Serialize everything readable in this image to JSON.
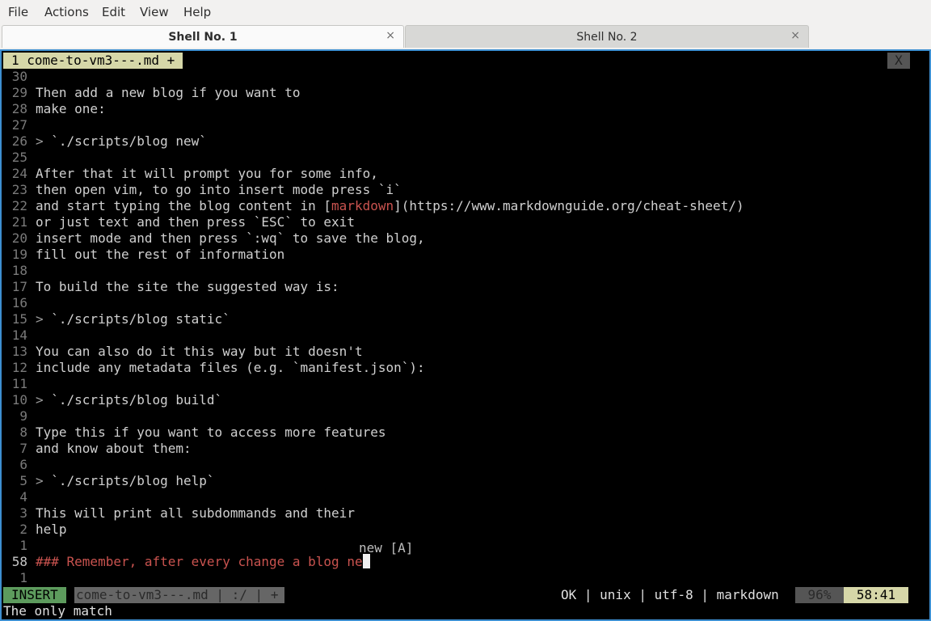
{
  "menubar": [
    "File",
    "Actions",
    "Edit",
    "View",
    "Help"
  ],
  "tabs": [
    {
      "label": "Shell No. 1",
      "close": "×"
    },
    {
      "label": "Shell No. 2",
      "close": "×"
    }
  ],
  "editor": {
    "buffer_tab": "1 come-to-vm3---.md +",
    "buffer_close": "X",
    "lines": [
      {
        "n": "30",
        "segs": []
      },
      {
        "n": "29",
        "segs": [
          {
            "t": "Then add a new blog if you want to"
          }
        ]
      },
      {
        "n": "28",
        "segs": [
          {
            "t": "make one:"
          }
        ]
      },
      {
        "n": "27",
        "segs": []
      },
      {
        "n": "26",
        "segs": [
          {
            "t": "> ",
            "c": "gray"
          },
          {
            "t": "`./scripts/blog new`"
          }
        ]
      },
      {
        "n": "25",
        "segs": []
      },
      {
        "n": "24",
        "segs": [
          {
            "t": "After that it will prompt you for some info,"
          }
        ]
      },
      {
        "n": "23",
        "segs": [
          {
            "t": "then open vim, to go into insert mode press `i`"
          }
        ]
      },
      {
        "n": "22",
        "segs": [
          {
            "t": "and start typing the blog content in ["
          },
          {
            "t": "markdown",
            "c": "red"
          },
          {
            "t": "](https://www.markdownguide.org/cheat-sheet/)"
          }
        ]
      },
      {
        "n": "21",
        "segs": [
          {
            "t": "or just text and then press `ESC` to exit"
          }
        ]
      },
      {
        "n": "20",
        "segs": [
          {
            "t": "insert mode and then press `:wq` to save the blog,"
          }
        ]
      },
      {
        "n": "19",
        "segs": [
          {
            "t": "fill out the rest of information"
          }
        ]
      },
      {
        "n": "18",
        "segs": []
      },
      {
        "n": "17",
        "segs": [
          {
            "t": "To build the site the suggested way is:"
          }
        ]
      },
      {
        "n": "16",
        "segs": []
      },
      {
        "n": "15",
        "segs": [
          {
            "t": "> ",
            "c": "gray"
          },
          {
            "t": "`./scripts/blog static`"
          }
        ]
      },
      {
        "n": "14",
        "segs": []
      },
      {
        "n": "13",
        "segs": [
          {
            "t": "You can also do it this way but it doesn't"
          }
        ]
      },
      {
        "n": "12",
        "segs": [
          {
            "t": "include any metadata files (e.g. `manifest.json`):"
          }
        ]
      },
      {
        "n": "11",
        "segs": []
      },
      {
        "n": "10",
        "segs": [
          {
            "t": "> ",
            "c": "gray"
          },
          {
            "t": "`./scripts/blog build`"
          }
        ]
      },
      {
        "n": "9",
        "segs": []
      },
      {
        "n": "8",
        "segs": [
          {
            "t": "Type this if you want to access more features"
          }
        ]
      },
      {
        "n": "7",
        "segs": [
          {
            "t": "and know about them:"
          }
        ]
      },
      {
        "n": "6",
        "segs": []
      },
      {
        "n": "5",
        "segs": [
          {
            "t": "> ",
            "c": "gray"
          },
          {
            "t": "`./scripts/blog help`"
          }
        ]
      },
      {
        "n": "4",
        "segs": []
      },
      {
        "n": "3",
        "segs": [
          {
            "t": "This will print all subdommands and their"
          }
        ]
      },
      {
        "n": "2",
        "segs": [
          {
            "t": "help"
          }
        ]
      },
      {
        "n": "1",
        "segs": []
      },
      {
        "n": "58",
        "current": true,
        "segs": [
          {
            "t": "### Remember, after every change a blog ne",
            "c": "red-heading"
          }
        ]
      },
      {
        "n": "1",
        "segs": []
      }
    ],
    "completion_hint": "new [A]"
  },
  "statusline": {
    "mode": "INSERT",
    "file": "come-to-vm3---.md | :/ | +",
    "info": "OK | unix | utf-8 | markdown",
    "percent": "96%",
    "position": "58:41"
  },
  "cmdline": "The only match"
}
